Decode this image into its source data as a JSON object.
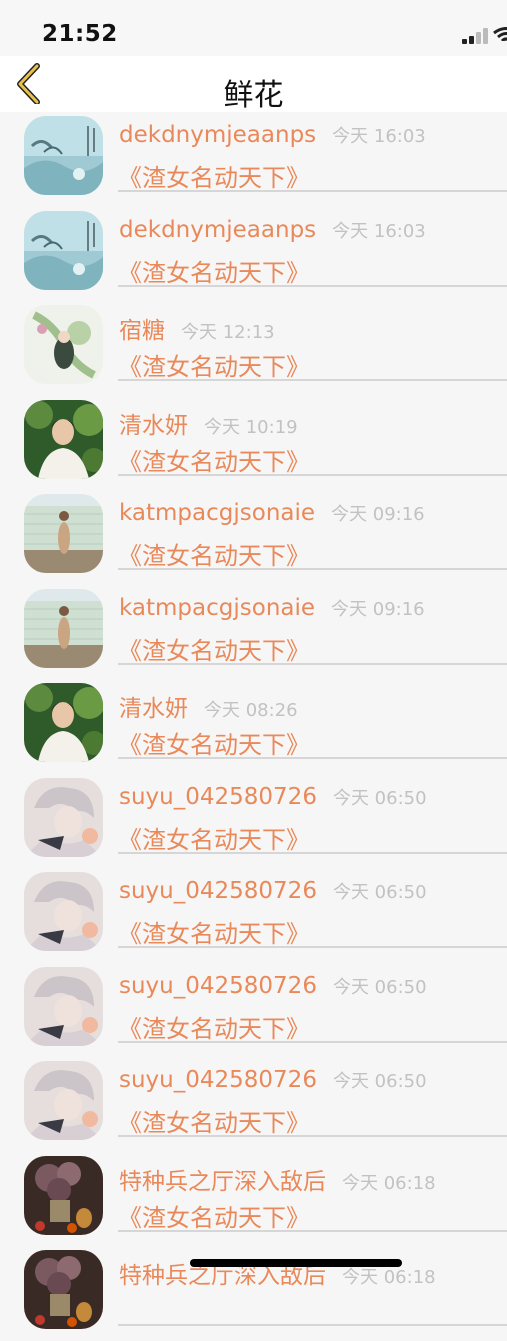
{
  "status_bar": {
    "time": "21:52"
  },
  "nav": {
    "title": "鲜花",
    "back_icon": "chevron-left-icon"
  },
  "colors": {
    "accent": "#e9895a",
    "timestamp": "#c2c2c2",
    "divider": "#d6d6d6",
    "back": "#e8c24a"
  },
  "items": [
    {
      "username": "dekdnymjeaanps",
      "time": "今天 16:03",
      "book": "《渣女名动天下》",
      "avatar": "landscape"
    },
    {
      "username": "dekdnymjeaanps",
      "time": "今天 16:03",
      "book": "《渣女名动天下》",
      "avatar": "landscape"
    },
    {
      "username": "宿糖",
      "time": "今天 12:13",
      "book": "《渣女名动天下》",
      "avatar": "painting"
    },
    {
      "username": "清水妍",
      "time": "今天 10:19",
      "book": "《渣女名动天下》",
      "avatar": "boy-white"
    },
    {
      "username": "katmpacgjsonaie",
      "time": "今天 09:16",
      "book": "《渣女名动天下》",
      "avatar": "person-wall"
    },
    {
      "username": "katmpacgjsonaie",
      "time": "今天 09:16",
      "book": "《渣女名动天下》",
      "avatar": "person-wall"
    },
    {
      "username": "清水妍",
      "time": "今天 08:26",
      "book": "《渣女名动天下》",
      "avatar": "boy-white"
    },
    {
      "username": "suyu_042580726",
      "time": "今天 06:50",
      "book": "《渣女名动天下》",
      "avatar": "sketch"
    },
    {
      "username": "suyu_042580726",
      "time": "今天 06:50",
      "book": "《渣女名动天下》",
      "avatar": "sketch"
    },
    {
      "username": "suyu_042580726",
      "time": "今天 06:50",
      "book": "《渣女名动天下》",
      "avatar": "sketch"
    },
    {
      "username": "suyu_042580726",
      "time": "今天 06:50",
      "book": "《渣女名动天下》",
      "avatar": "sketch"
    },
    {
      "username": "特种兵之厅深入敌后",
      "time": "今天 06:18",
      "book": "《渣女名动天下》",
      "avatar": "flowers"
    },
    {
      "username": "特种兵之厅深入敌后",
      "time": "今天 06:18",
      "book": "",
      "avatar": "flowers"
    }
  ]
}
